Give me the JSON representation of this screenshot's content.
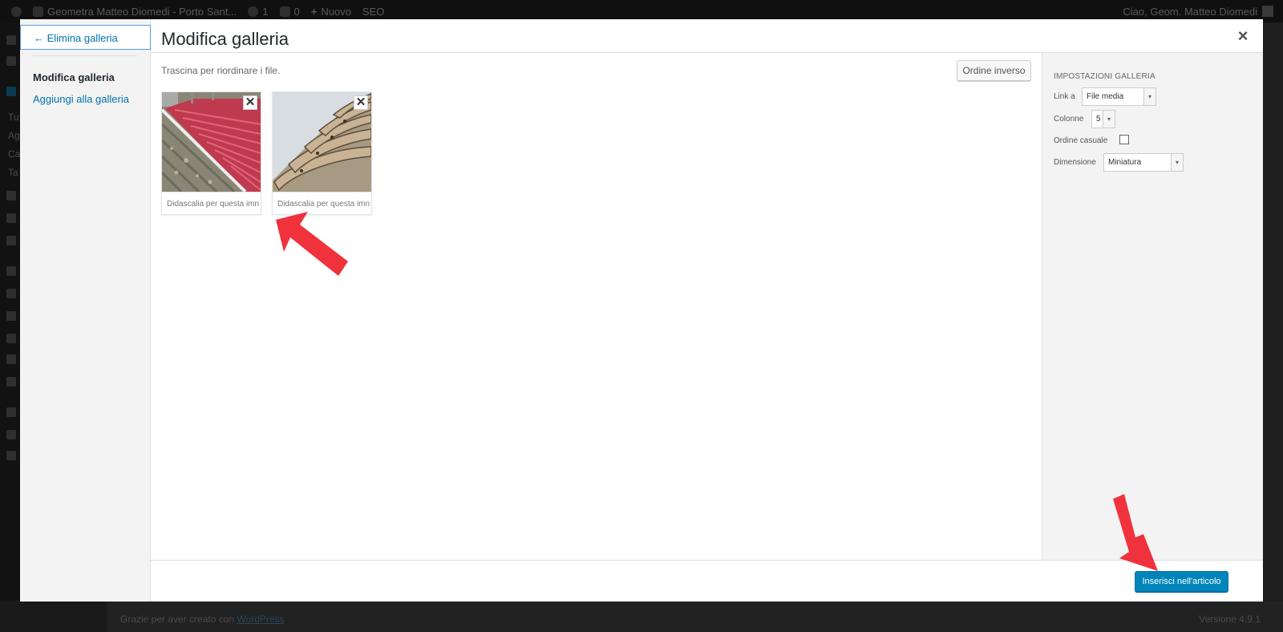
{
  "admin_bar": {
    "site_name": "Geometra Matteo Diomedi - Porto Sant...",
    "updates_count": "1",
    "comments_count": "0",
    "new_label": "Nuovo",
    "seo_label": "SEO",
    "greeting": "Ciao, Geom. Matteo Diomedi"
  },
  "admin_menu": {
    "partial_labels": [
      "Tu",
      "Ag",
      "Ca",
      "Ta"
    ]
  },
  "footer": {
    "thanks_prefix": "Grazie per aver creato con",
    "thanks_link": "WordPress",
    "version": "Versione 4.9.1"
  },
  "modal": {
    "menu": {
      "back_label": "← Elimina galleria",
      "current_label": "Modifica galleria",
      "add_label": "Aggiungi alla galleria"
    },
    "title": "Modifica galleria",
    "close_glyph": "×",
    "instructions": "Trascina per riordinare i file.",
    "reverse_label": "Ordine inverso",
    "attachments": [
      {
        "caption": "Didascalia per questa imn",
        "remove_glyph": "✕"
      },
      {
        "caption": "Didascalia per questa imn",
        "remove_glyph": "✕"
      }
    ],
    "settings": {
      "heading": "Impostazioni galleria",
      "link_label": "Link a",
      "link_value": "File media",
      "columns_label": "Colonne",
      "columns_value": "5",
      "random_label": "Ordine casuale",
      "random_checked": false,
      "size_label": "Dimensione",
      "size_value": "Miniatura"
    },
    "insert_label": "Inserisci nell'articolo"
  },
  "colors": {
    "primary_button": "#0085ba",
    "link": "#0073aa",
    "annotation_arrow": "#f0323c"
  }
}
